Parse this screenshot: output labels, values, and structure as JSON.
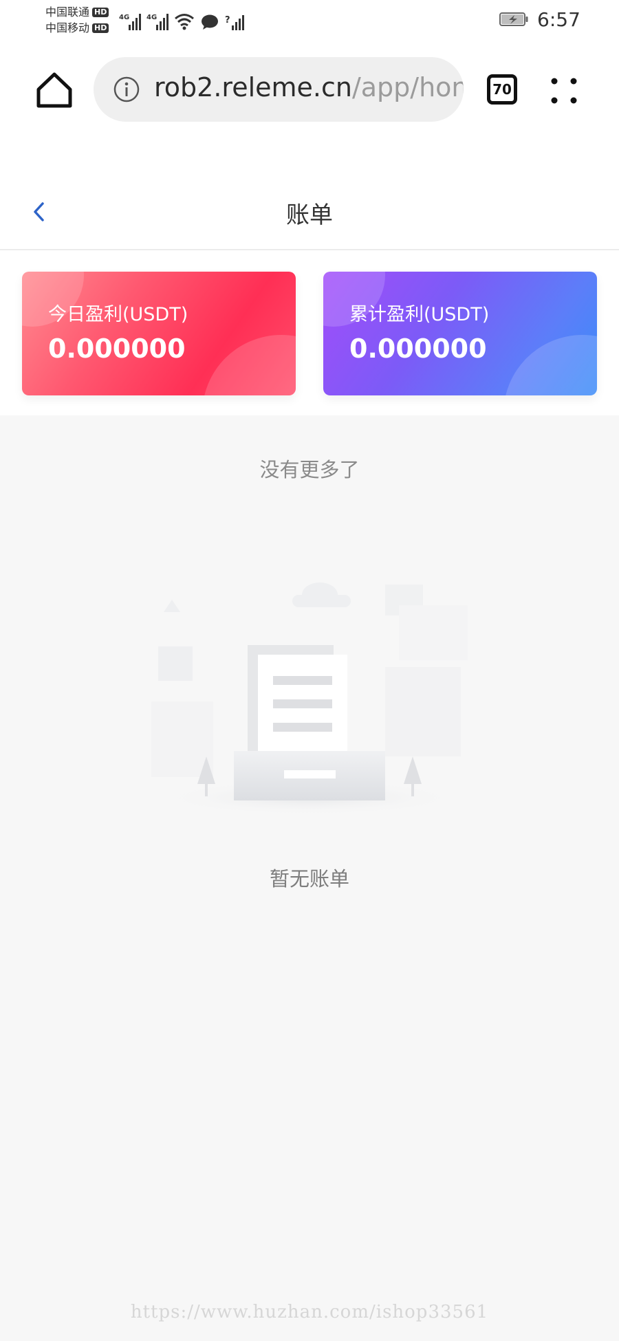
{
  "status_bar": {
    "carrier_1": "中国联通",
    "carrier_2": "中国移动",
    "hd_badge": "HD",
    "network_1": "4G",
    "network_2": "4G",
    "unknown_signal": "?",
    "time": "6:57"
  },
  "browser": {
    "url_domain": "rob2.releme.cn",
    "url_path": "/app/hon",
    "tab_count": "70",
    "icons": {
      "home": "home-icon",
      "info": "info-icon",
      "menu": "menu-icon"
    }
  },
  "header": {
    "title": "账单",
    "back_icon": "chevron-left-icon"
  },
  "cards": [
    {
      "label": "今日盈利(USDT)",
      "value": "0.000000",
      "color": "#ff3a5c"
    },
    {
      "label": "累计盈利(USDT)",
      "value": "0.000000",
      "color": "#7b5cf8"
    }
  ],
  "list": {
    "no_more_text": "没有更多了",
    "empty_text": "暂无账单",
    "empty_icon": "empty-bill-illustration"
  },
  "watermark": "https://www.huzhan.com/ishop33561"
}
